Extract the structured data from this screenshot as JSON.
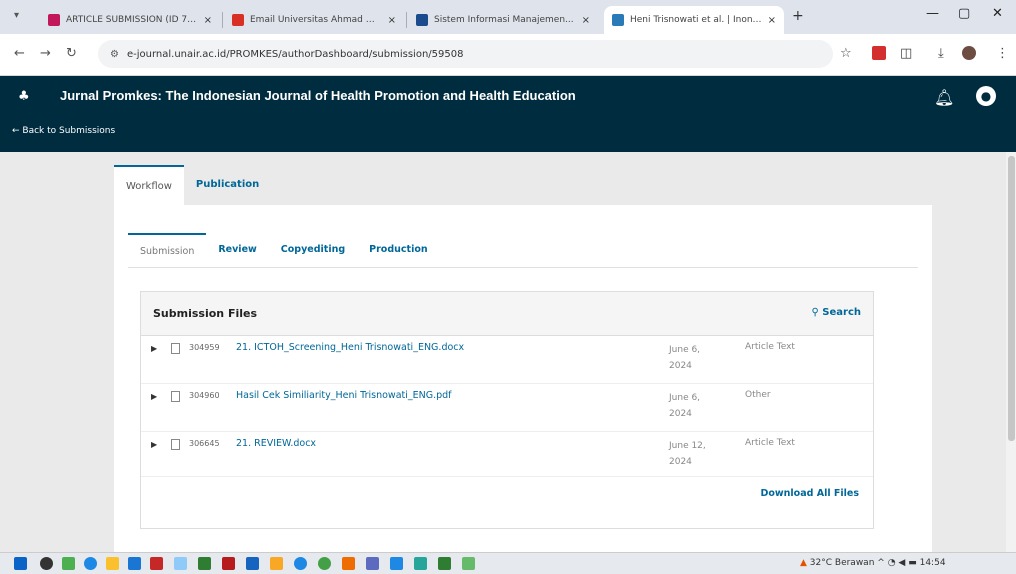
{
  "browser": {
    "tabs": [
      {
        "title": "ARTICLE SUBMISSION (ID 703...",
        "favicon_color": "#c2185b"
      },
      {
        "title": "Email Universitas Ahmad Dahla...",
        "favicon_color": "#d93025"
      },
      {
        "title": "Sistem Informasi Manajemen...",
        "favicon_color": "#1a4b8c"
      },
      {
        "title": "Heni Trisnowati et al. | Inonesi...",
        "favicon_color": "#2a7ab8"
      }
    ],
    "url": "e-journal.unair.ac.id/PROMKES/authorDashboard/submission/59508"
  },
  "header": {
    "journal_title": "Jurnal Promkes: The Indonesian Journal of Health Promotion and Health Education",
    "back_link": "← Back to Submissions"
  },
  "main_tabs": [
    "Workflow",
    "Publication"
  ],
  "sub_tabs": [
    "Submission",
    "Review",
    "Copyediting",
    "Production"
  ],
  "files_panel": {
    "title": "Submission Files",
    "search_label": "Search",
    "download_all_label": "Download All Files",
    "files": [
      {
        "id": "304959",
        "name": "21. ICTOH_Screening_Heni Trisnowati_ENG.docx",
        "date": "June 6, 2024",
        "type": "Article Text"
      },
      {
        "id": "304960",
        "name": "Hasil Cek Similiarity_Heni Trisnowati_ENG.pdf",
        "date": "June 6, 2024",
        "type": "Other"
      },
      {
        "id": "306645",
        "name": "21. REVIEW.docx",
        "date": "June 12, 2024",
        "type": "Article Text"
      }
    ]
  },
  "taskbar": {
    "weather": "32°C Berawan",
    "time": "14:54"
  }
}
